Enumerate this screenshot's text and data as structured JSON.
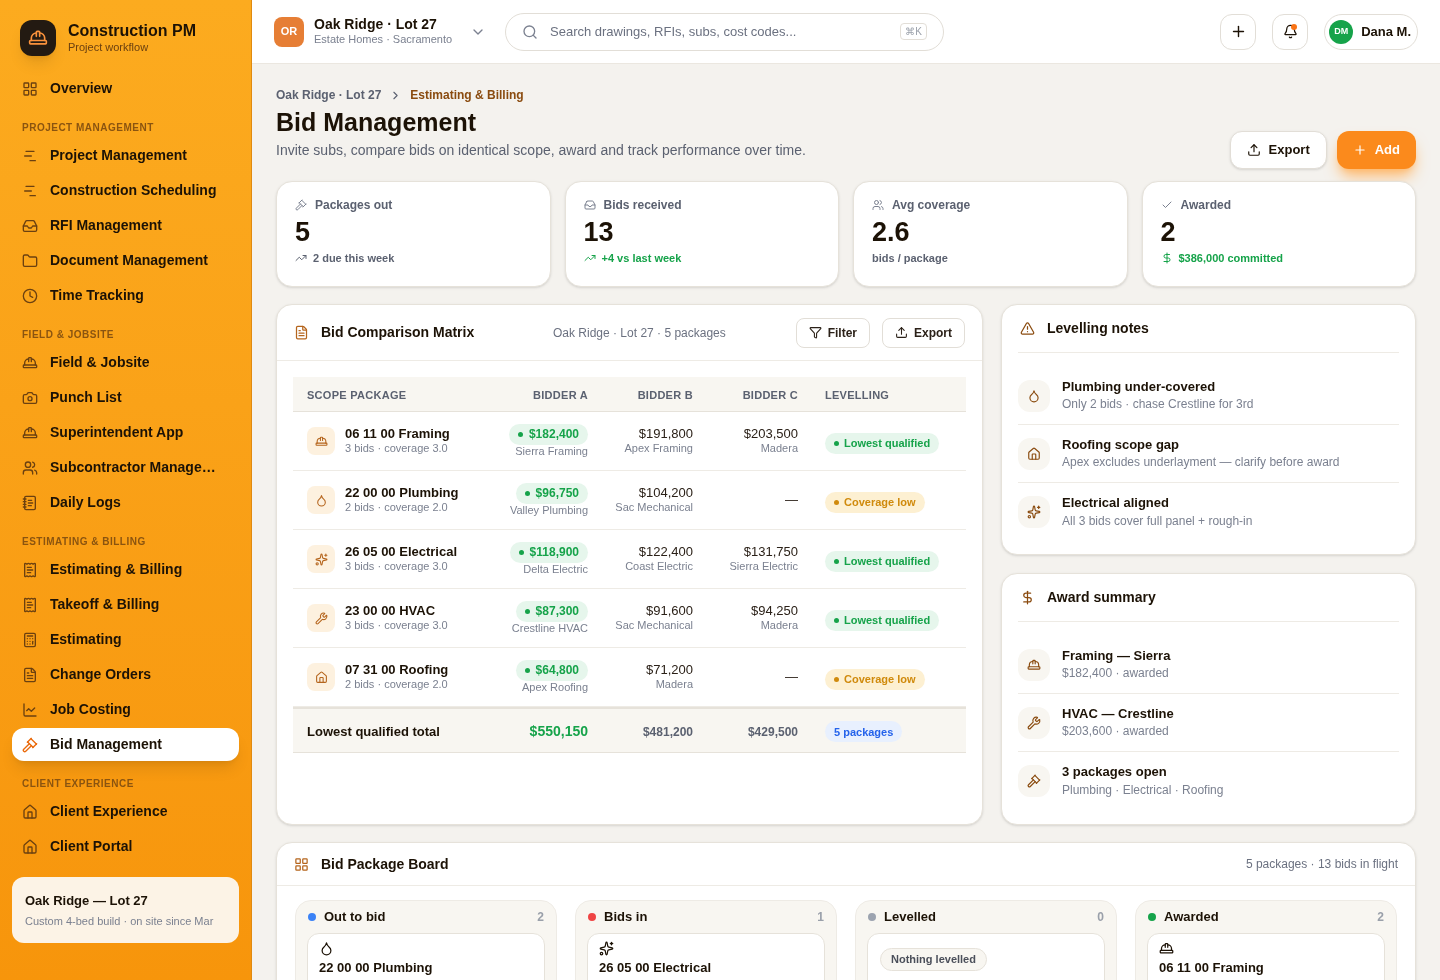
{
  "brand": {
    "name": "Construction PM",
    "tagline": "Project workflow"
  },
  "sidebar": {
    "top": [
      {
        "label": "Overview",
        "selected": false
      }
    ],
    "sections": [
      {
        "title": "PROJECT MANAGEMENT",
        "items": [
          {
            "label": "Project Management",
            "selected": false
          },
          {
            "label": "Construction Scheduling",
            "selected": false
          },
          {
            "label": "RFI Management",
            "selected": false
          },
          {
            "label": "Document Management",
            "selected": false
          },
          {
            "label": "Time Tracking",
            "selected": false
          }
        ]
      },
      {
        "title": "FIELD & JOBSITE",
        "items": [
          {
            "label": "Field & Jobsite",
            "selected": false
          },
          {
            "label": "Punch List",
            "selected": false
          },
          {
            "label": "Superintendent App",
            "selected": false
          },
          {
            "label": "Subcontractor Manage…",
            "selected": false
          },
          {
            "label": "Daily Logs",
            "selected": false
          }
        ]
      },
      {
        "title": "ESTIMATING & BILLING",
        "items": [
          {
            "label": "Estimating & Billing",
            "selected": false
          },
          {
            "label": "Takeoff & Billing",
            "selected": false
          },
          {
            "label": "Estimating",
            "selected": false
          },
          {
            "label": "Change Orders",
            "selected": false
          },
          {
            "label": "Job Costing",
            "selected": false
          },
          {
            "label": "Bid Management",
            "selected": true
          }
        ]
      },
      {
        "title": "CLIENT EXPERIENCE",
        "items": [
          {
            "label": "Client Experience",
            "selected": false
          },
          {
            "label": "Client Portal",
            "selected": false
          }
        ]
      }
    ],
    "project_card": {
      "title": "Oak Ridge — Lot 27",
      "subtitle": "Custom 4-bed build · on site since Mar"
    }
  },
  "topbar": {
    "project_badge": "OR",
    "project_name": "Oak Ridge · Lot 27",
    "project_sub": "Estate Homes · Sacramento",
    "search_placeholder": "Search drawings, RFIs, subs, cost codes...",
    "shortcut": "⌘K",
    "user_initials": "DM",
    "user_name": "Dana M.",
    "notification": true
  },
  "breadcrumb": [
    "Oak Ridge · Lot 27",
    "Estimating & Billing"
  ],
  "page": {
    "title": "Bid Management",
    "subtitle": "Invite subs, compare bids on identical scope, award and track performance over time.",
    "buttons": [
      "Export",
      "Add"
    ]
  },
  "stats": [
    {
      "label": "Packages out",
      "value": "5",
      "note": "2 due this week",
      "positive": false
    },
    {
      "label": "Bids received",
      "value": "13",
      "note": "+4 vs last week",
      "positive": true
    },
    {
      "label": "Avg coverage",
      "value": "2.6",
      "note": "bids / package",
      "positive": false
    },
    {
      "label": "Awarded",
      "value": "2",
      "note": "$386,000 committed",
      "positive": true
    }
  ],
  "matrix": {
    "title": "Bid Comparison Matrix",
    "context": "Oak Ridge · Lot 27 · 5 packages",
    "buttons": [
      "Filter",
      "Export"
    ],
    "columns": [
      "SCOPE PACKAGE",
      "BIDDER A",
      "BIDDER B",
      "BIDDER C",
      "LEVELLING"
    ],
    "rows": [
      {
        "package": "06 11 00 Framing",
        "meta": "3 bids · coverage 3.0",
        "bids": [
          {
            "amount": "$182,400",
            "bidder": "Sierra Framing",
            "lowest": true
          },
          {
            "amount": "$191,800",
            "bidder": "Apex Framing",
            "lowest": false
          },
          {
            "amount": "$203,500",
            "bidder": "Madera",
            "lowest": false
          }
        ],
        "levelling": {
          "label": "Lowest qualified",
          "kind": "good"
        }
      },
      {
        "package": "22 00 00 Plumbing",
        "meta": "2 bids · coverage 2.0",
        "bids": [
          {
            "amount": "$96,750",
            "bidder": "Valley Plumbing",
            "lowest": true
          },
          {
            "amount": "$104,200",
            "bidder": "Sac Mechanical",
            "lowest": false
          },
          {
            "amount": "—",
            "lowest": false
          }
        ],
        "levelling": {
          "label": "Coverage low",
          "kind": "low"
        }
      },
      {
        "package": "26 05 00 Electrical",
        "meta": "3 bids · coverage 3.0",
        "bids": [
          {
            "amount": "$118,900",
            "bidder": "Delta Electric",
            "lowest": true
          },
          {
            "amount": "$122,400",
            "bidder": "Coast Electric",
            "lowest": false
          },
          {
            "amount": "$131,750",
            "bidder": "Sierra Electric",
            "lowest": false
          }
        ],
        "levelling": {
          "label": "Lowest qualified",
          "kind": "good"
        }
      },
      {
        "package": "23 00 00 HVAC",
        "meta": "3 bids · coverage 3.0",
        "bids": [
          {
            "amount": "$87,300",
            "bidder": "Crestline HVAC",
            "lowest": true
          },
          {
            "amount": "$91,600",
            "bidder": "Sac Mechanical",
            "lowest": false
          },
          {
            "amount": "$94,250",
            "bidder": "Madera",
            "lowest": false
          }
        ],
        "levelling": {
          "label": "Lowest qualified",
          "kind": "good"
        }
      },
      {
        "package": "07 31 00 Roofing",
        "meta": "2 bids · coverage 2.0",
        "bids": [
          {
            "amount": "$64,800",
            "bidder": "Apex Roofing",
            "lowest": true
          },
          {
            "amount": "$71,200",
            "bidder": "Madera",
            "lowest": false
          },
          {
            "amount": "—",
            "lowest": false
          }
        ],
        "levelling": {
          "label": "Coverage low",
          "kind": "low"
        }
      }
    ],
    "total": {
      "label": "Lowest qualified total",
      "values": [
        "$550,150",
        "$481,200",
        "$429,500"
      ],
      "badge": "5 packages"
    }
  },
  "notes": {
    "title": "Levelling notes",
    "items": [
      {
        "title": "Plumbing under-covered",
        "detail": "Only 2 bids · chase Crestline for 3rd"
      },
      {
        "title": "Roofing scope gap",
        "detail": "Apex excludes underlayment — clarify before award"
      },
      {
        "title": "Electrical aligned",
        "detail": "All 3 bids cover full panel + rough-in"
      }
    ]
  },
  "award_summary": {
    "title": "Award summary",
    "items": [
      {
        "title": "Framing — Sierra",
        "detail": "$182,400 · awarded"
      },
      {
        "title": "HVAC — Crestline",
        "detail": "$203,600 · awarded"
      },
      {
        "title": "3 packages open",
        "detail": "Plumbing · Electrical · Roofing"
      }
    ]
  },
  "board": {
    "title": "Bid Package Board",
    "summary": "5 packages · 13 bids in flight",
    "columns": [
      {
        "name": "Out to bid",
        "count": "2",
        "color": "#3b82f6",
        "cards": [
          {
            "kind": "package",
            "title": "22 00 00 Plumbing"
          }
        ]
      },
      {
        "name": "Bids in",
        "count": "1",
        "color": "#ef4444",
        "cards": [
          {
            "kind": "package",
            "title": "26 05 00 Electrical"
          }
        ]
      },
      {
        "name": "Levelled",
        "count": "0",
        "color": "#9ca3af",
        "cards": [
          {
            "kind": "empty",
            "title": "Nothing levelled"
          }
        ]
      },
      {
        "name": "Awarded",
        "count": "2",
        "color": "#16a34a",
        "cards": [
          {
            "kind": "package",
            "title": "06 11 00 Framing"
          }
        ]
      }
    ]
  }
}
